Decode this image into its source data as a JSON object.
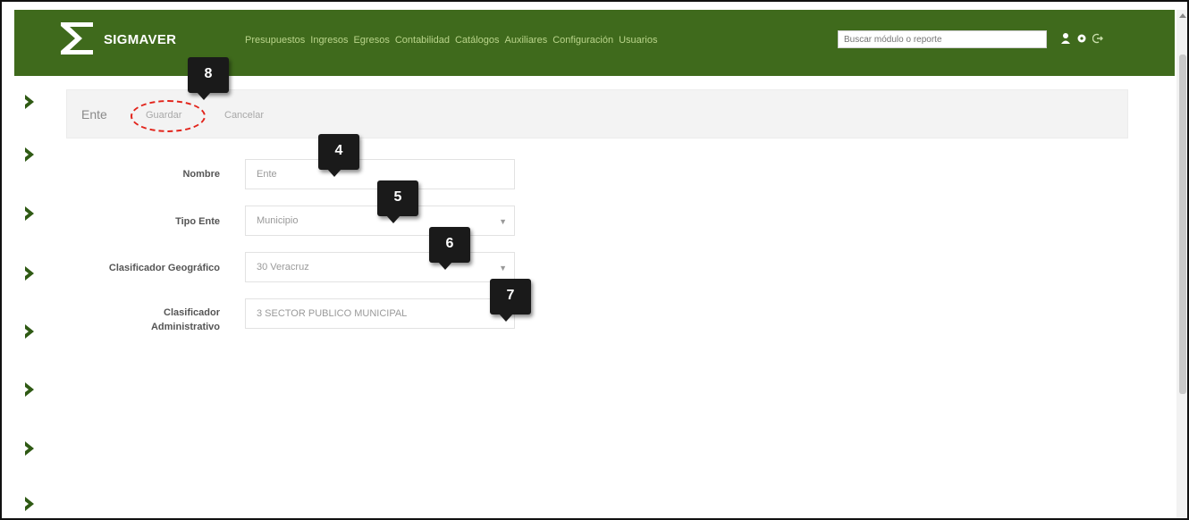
{
  "app": {
    "brand": "SIGMAVER"
  },
  "nav": {
    "items": [
      "Presupuestos",
      "Ingresos",
      "Egresos",
      "Contabilidad",
      "Catálogos",
      "Auxiliares",
      "Configuración",
      "Usuarios"
    ]
  },
  "search": {
    "placeholder": "Buscar módulo o reporte"
  },
  "top_icons": [
    "user-icon",
    "gear-icon",
    "logout-icon"
  ],
  "breadcrumb": {
    "title": "Ente",
    "save_label": "Guardar",
    "cancel_label": "Cancelar"
  },
  "form": {
    "nombre": {
      "label": "Nombre",
      "value": "Ente"
    },
    "tipo_ente": {
      "label": "Tipo Ente",
      "value": "Municipio"
    },
    "clasificador_geo": {
      "label": "Clasificador Geográfico",
      "value": "30 Veracruz"
    },
    "clasificador_admin": {
      "label_line1": "Clasificador",
      "label_line2": "Administrativo",
      "value": "3 SECTOR PUBLICO MUNICIPAL"
    }
  },
  "callouts": [
    "8",
    "4",
    "5",
    "6",
    "7"
  ],
  "colors": {
    "topbar": "#3f6a1c",
    "nav_text": "#b9d48a",
    "highlight_ring": "#e2231a",
    "chevron": "#2f5a14"
  }
}
